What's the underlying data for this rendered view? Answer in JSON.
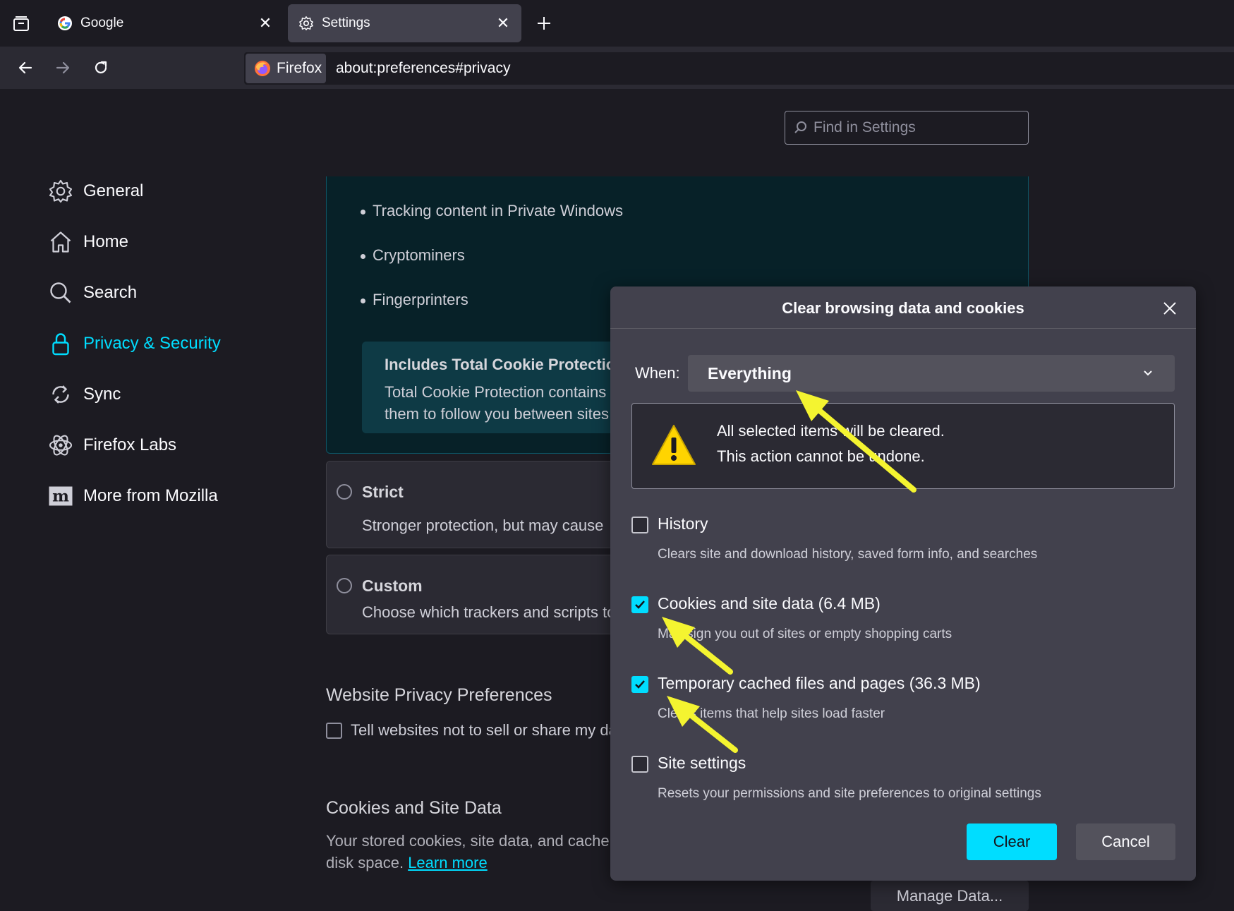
{
  "tabs": [
    {
      "title": "Google",
      "icon": "google-icon"
    },
    {
      "title": "Settings",
      "icon": "gear-icon",
      "active": true
    }
  ],
  "navbar": {
    "identity_label": "Firefox",
    "url": "about:preferences#privacy"
  },
  "search": {
    "placeholder": "Find in Settings"
  },
  "sidebar": {
    "items": [
      {
        "label": "General",
        "icon": "gear-icon"
      },
      {
        "label": "Home",
        "icon": "home-icon"
      },
      {
        "label": "Search",
        "icon": "search-icon"
      },
      {
        "label": "Privacy & Security",
        "icon": "lock-icon",
        "active": true
      },
      {
        "label": "Sync",
        "icon": "sync-icon"
      },
      {
        "label": "Firefox Labs",
        "icon": "labs-icon"
      },
      {
        "label": "More from Mozilla",
        "icon": "mozilla-icon"
      }
    ]
  },
  "protection": {
    "bullets": [
      "Tracking content in Private Windows",
      "Cryptominers",
      "Fingerprinters"
    ],
    "tcp_title": "Includes Total Cookie Protection",
    "tcp_line1": "Total Cookie Protection contains",
    "tcp_line2": "them to follow you between sites"
  },
  "strict": {
    "title": "Strict",
    "desc": "Stronger protection, but may cause"
  },
  "custom": {
    "title": "Custom",
    "desc": "Choose which trackers and scripts to"
  },
  "website_privacy": {
    "title": "Website Privacy Preferences",
    "checkbox": "Tell websites not to sell or share my data"
  },
  "cookies_section": {
    "title": "Cookies and Site Data",
    "line1": "Your stored cookies, site data, and cache",
    "line2_prefix": "disk space.",
    "learn_more": "Learn more",
    "manage_button": "Manage Data..."
  },
  "dialog": {
    "title": "Clear browsing data and cookies",
    "when_label": "When:",
    "when_value": "Everything",
    "warning_line1": "All selected items will be cleared.",
    "warning_line2": "This action cannot be undone.",
    "options": [
      {
        "label": "History",
        "desc": "Clears site and download history, saved form info, and searches",
        "checked": false
      },
      {
        "label": "Cookies and site data (6.4 MB)",
        "desc": "May sign you out of sites or empty shopping carts",
        "checked": true
      },
      {
        "label": "Temporary cached files and pages (36.3 MB)",
        "desc": "Clears items that help sites load faster",
        "checked": true
      },
      {
        "label": "Site settings",
        "desc": "Resets your permissions and site preferences to original settings",
        "checked": false
      }
    ],
    "clear_button": "Clear",
    "cancel_button": "Cancel"
  },
  "colors": {
    "accent": "#00ddff",
    "annotation_arrow": "#f4f430",
    "dialog_bg": "#42414d",
    "page_bg": "#1c1b22"
  }
}
